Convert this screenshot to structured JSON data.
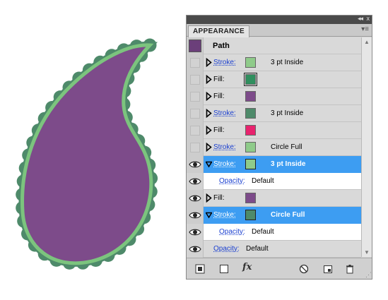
{
  "colors": {
    "paisley_fill": "#7d4b8a",
    "paisley_inner_stroke": "#7cc47e",
    "paisley_scallops": "#4e8a6a",
    "selection": "#3d9df2",
    "link": "#1a3fd0"
  },
  "panel": {
    "title": "APPEARANCE",
    "close_glyph": "x",
    "collapse_glyph": "◂◂",
    "close_panel_glyph": "x",
    "menu_glyph": "▾≡",
    "object_label": "Path",
    "rows": [
      {
        "label": "Stroke:",
        "link": true,
        "swatch": "#8fcb8a",
        "value": "3 pt  Inside",
        "eye": false,
        "selected": false
      },
      {
        "label": "Fill:",
        "link": false,
        "swatch": "#2f8f5e",
        "swatch_boxed": true,
        "value": "",
        "eye": false,
        "selected": false
      },
      {
        "label": "Fill:",
        "link": false,
        "swatch": "#7d4b8a",
        "value": "",
        "eye": false,
        "selected": false
      },
      {
        "label": "Stroke:",
        "link": true,
        "swatch": "#4e8a6a",
        "value": "3 pt  Inside",
        "eye": false,
        "selected": false
      },
      {
        "label": "Fill:",
        "link": false,
        "swatch": "#e8236e",
        "value": "",
        "eye": false,
        "selected": false
      },
      {
        "label": "Stroke:",
        "link": true,
        "swatch": "#8fcb8a",
        "value": "Circle Full",
        "eye": false,
        "selected": false
      },
      {
        "label": "Stroke:",
        "link": true,
        "swatch": "#8fcb8a",
        "value": "3 pt  Inside",
        "eye": true,
        "selected": true,
        "expanded": true
      },
      {
        "sub": true,
        "label": "Opacity:",
        "value": "Default",
        "eye": true
      },
      {
        "label": "Fill:",
        "link": false,
        "swatch": "#7d4b8a",
        "value": "",
        "eye": true,
        "selected": false
      },
      {
        "label": "Stroke:",
        "link": true,
        "swatch": "#4e8a6a",
        "value": "Circle Full",
        "eye": true,
        "selected": true,
        "expanded": true
      },
      {
        "sub": true,
        "label": "Opacity:",
        "value": "Default",
        "eye": true
      },
      {
        "top_opacity": true,
        "label": "Opacity:",
        "value": "Default",
        "eye": true
      }
    ],
    "footer_icons": [
      "add-new-stroke-icon",
      "add-new-fill-icon",
      "add-effect-icon",
      "clear-appearance-icon",
      "duplicate-item-icon",
      "delete-item-icon"
    ],
    "fx_label": "fx"
  }
}
